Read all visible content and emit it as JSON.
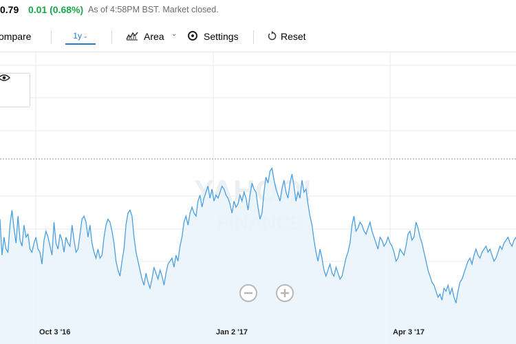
{
  "quote": {
    "price": "0.79",
    "change": "0.01 (0.68%)",
    "status": "As of 4:58PM BST. Market closed."
  },
  "toolbar": {
    "compare_label": "ompare",
    "range_label": "1y",
    "chart_type_label": "Area",
    "settings_label": "Settings",
    "reset_label": "Reset"
  },
  "watermark": {
    "line1": "YAHOO!",
    "line2": "FINANCE"
  },
  "icons": [
    "eye-icon",
    "area-chart-icon",
    "chevron-down-icon",
    "gear-icon",
    "reset-icon",
    "zoom-out-icon",
    "zoom-in-icon"
  ],
  "colors": {
    "line": "#4a9fe0",
    "area": "#e9f3fc",
    "positive": "#1aa74a",
    "accent": "#1e7bd9"
  },
  "chart_data": {
    "type": "area",
    "title": "",
    "xlabel": "",
    "ylabel": "",
    "grid": true,
    "x_ticks": [
      "Oct 3 '16",
      "Jan 2 '17",
      "Apr 3 '17"
    ],
    "values": [
      2.6,
      1.4,
      2.0,
      1.6,
      1.5,
      2.4,
      2.9,
      2.3,
      1.8,
      2.7,
      1.9,
      1.7,
      2.4,
      2.0,
      2.1,
      1.6,
      1.5,
      1.8,
      2.0,
      1.6,
      1.5,
      1.1,
      1.9,
      2.2,
      2.0,
      1.7,
      1.4,
      2.5,
      1.8,
      1.6,
      2.1,
      1.9,
      1.5,
      2.0,
      1.8,
      1.7,
      2.4,
      1.9,
      1.5,
      1.6,
      2.1,
      2.6,
      2.7,
      2.5,
      2.0,
      2.4,
      1.8,
      1.5,
      1.3,
      1.6,
      1.3,
      1.4,
      2.0,
      2.4,
      2.6,
      2.5,
      2.2,
      1.8,
      1.2,
      0.9,
      0.7,
      1.2,
      1.6,
      2.4,
      2.8,
      2.9,
      2.7,
      2.0,
      1.5,
      1.2,
      0.9,
      0.6,
      0.4,
      0.8,
      0.5,
      0.3,
      0.6,
      1.0,
      0.8,
      0.6,
      0.9,
      0.7,
      0.4,
      0.8,
      1.1,
      1.2,
      1.3,
      1.0,
      1.4,
      1.2,
      1.7,
      2.0,
      2.5,
      2.7,
      2.4,
      2.8,
      3.0,
      2.8,
      2.7,
      3.2,
      3.4,
      3.0,
      3.3,
      3.5,
      3.7,
      3.3,
      3.6,
      3.2,
      3.4,
      3.3,
      3.5,
      3.7,
      3.6,
      3.4,
      3.3,
      3.1,
      2.8,
      3.2,
      3.0,
      3.1,
      3.4,
      3.2,
      3.5,
      3.3,
      2.9,
      3.4,
      3.8,
      3.6,
      3.5,
      3.0,
      2.6,
      2.8,
      3.5,
      4.0,
      3.8,
      4.2,
      4.3,
      3.9,
      3.6,
      3.4,
      3.2,
      3.6,
      3.9,
      3.5,
      3.3,
      3.8,
      4.1,
      3.7,
      3.2,
      3.5,
      3.3,
      3.9,
      3.5,
      3.6,
      3.1,
      2.7,
      2.4,
      1.9,
      1.5,
      1.2,
      1.6,
      1.3,
      0.9,
      0.7,
      0.9,
      1.1,
      0.8,
      0.7,
      1.0,
      0.8,
      0.6,
      0.7,
      1.0,
      1.3,
      1.5,
      1.8,
      2.4,
      2.7,
      2.2,
      2.3,
      2.5,
      2.4,
      2.2,
      2.1,
      2.3,
      2.5,
      2.2,
      2.0,
      1.8,
      1.6,
      2.0,
      1.9,
      1.7,
      1.8,
      2.0,
      1.8,
      1.7,
      1.5,
      1.2,
      1.3,
      1.6,
      1.5,
      1.4,
      1.7,
      2.1,
      2.2,
      1.9,
      2.0,
      2.5,
      2.3,
      2.0,
      1.8,
      1.5,
      1.2,
      0.9,
      0.7,
      0.5,
      0.4,
      0.2,
      0.0,
      0.1,
      -0.1,
      0.3,
      0.2,
      0.4,
      0.1,
      0.3,
      0.0,
      -0.2,
      0.2,
      0.5,
      0.6,
      0.8,
      1.0,
      1.2,
      1.3,
      1.1,
      1.4,
      1.6,
      1.4,
      1.3,
      1.5,
      1.6,
      1.7,
      1.5,
      1.6,
      1.4,
      1.2,
      1.3,
      1.5,
      1.7,
      1.6,
      1.8,
      1.9,
      2.0,
      1.8,
      1.7,
      1.9,
      2.0
    ]
  }
}
